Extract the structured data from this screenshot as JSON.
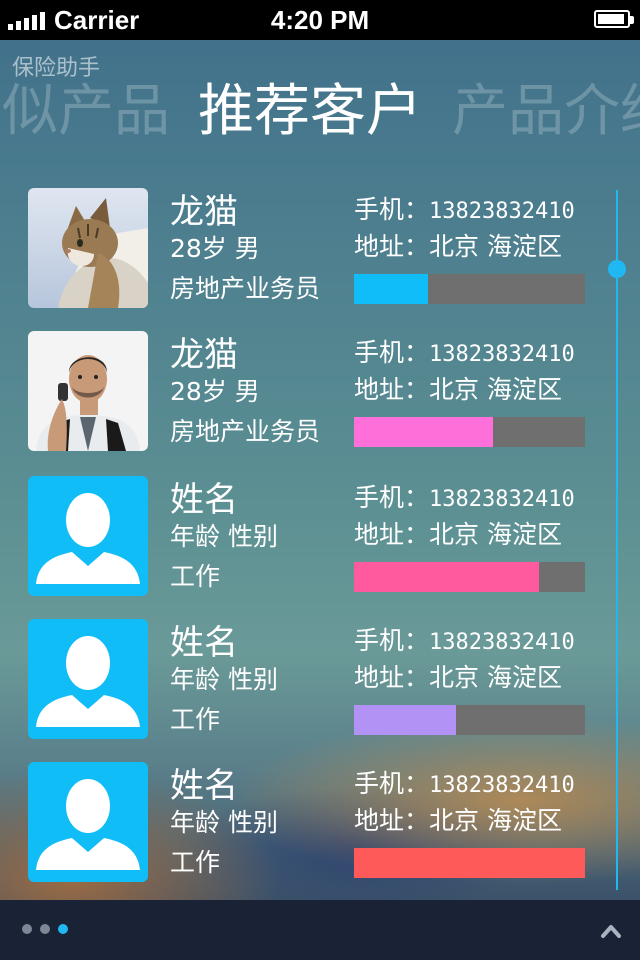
{
  "status_bar": {
    "carrier": "Carrier",
    "time": "4:20 PM"
  },
  "app_title": "保险助手",
  "tabs": {
    "prev": "类似产品",
    "current": "推荐客户",
    "next": "产品介绍"
  },
  "customers": [
    {
      "name": "龙猫",
      "age_gender": "28岁 男",
      "job": "房地产业务员",
      "phone_label": "手机：",
      "phone": "13823832410",
      "address": "地址：北京 海淀区",
      "progress": 0.32,
      "bar_color": "#11bdf6",
      "avatar": "cat-photo"
    },
    {
      "name": "龙猫",
      "age_gender": "28岁 男",
      "job": "房地产业务员",
      "phone_label": "手机：",
      "phone": "13823832410",
      "address": "地址：北京 海淀区",
      "progress": 0.6,
      "bar_color": "#ff6fd9",
      "avatar": "man-photo"
    },
    {
      "name": "姓名",
      "age_gender": "年龄 性别",
      "job": "工作",
      "phone_label": "手机：",
      "phone": "13823832410",
      "address": "地址：北京 海淀区",
      "progress": 0.8,
      "bar_color": "#ff5a9e",
      "avatar": "default-user-icon"
    },
    {
      "name": "姓名",
      "age_gender": "年龄 性别",
      "job": "工作",
      "phone_label": "手机：",
      "phone": "13823832410",
      "address": "地址：北京 海淀区",
      "progress": 0.44,
      "bar_color": "#b392f5",
      "avatar": "default-user-icon"
    },
    {
      "name": "姓名",
      "age_gender": "年龄 性别",
      "job": "工作",
      "phone_label": "手机：",
      "phone": "13823832410",
      "address": "地址：北京 海淀区",
      "progress": 1.0,
      "bar_color": "#ff5a5a",
      "avatar": "default-user-icon"
    }
  ],
  "pager": {
    "count": 3,
    "active_index": 2
  },
  "colors": {
    "accent": "#1fb8f2",
    "bar_track": "#6f6f6f",
    "bottom_bar": "#1a2236"
  }
}
